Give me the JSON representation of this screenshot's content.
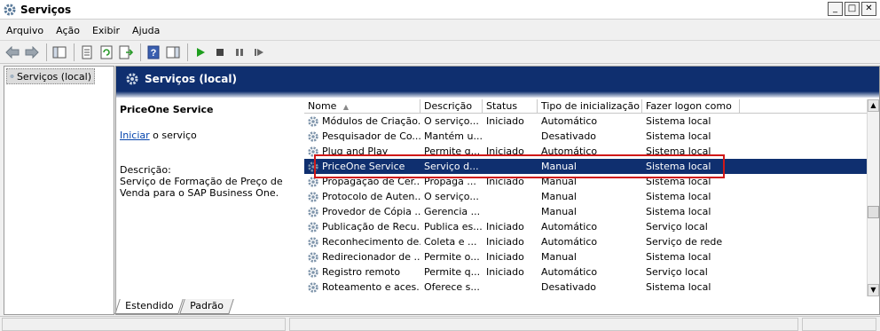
{
  "window": {
    "title": "Serviços",
    "app_icon": "gear-icon",
    "controls": [
      "minimize",
      "maximize",
      "close"
    ]
  },
  "menu": [
    "Arquivo",
    "Ação",
    "Exibir",
    "Ajuda"
  ],
  "toolbar_icons": [
    "back-arrow-icon",
    "forward-arrow-icon",
    "show-hide-tree-icon",
    "properties-icon",
    "refresh-icon",
    "export-list-icon",
    "help-icon",
    "show-hide-action-pane-icon",
    "play-icon",
    "stop-icon",
    "pause-icon",
    "restart-icon"
  ],
  "tree": {
    "root": "Serviços (local)"
  },
  "main": {
    "header": "Serviços (local)",
    "description_panel": {
      "service_name": "PriceOne Service",
      "start_link": "Iniciar",
      "start_suffix": " o serviço",
      "desc_label": "Descrição:",
      "desc_text": "Serviço de Formação de Preço de Venda para o SAP Business One."
    },
    "columns": [
      "Nome",
      "Descrição",
      "Status",
      "Tipo de inicialização",
      "Fazer logon como"
    ],
    "rows": [
      {
        "name": "Módulos de Criação...",
        "desc": "O serviço...",
        "status": "Iniciado",
        "type": "Automático",
        "logon": "Sistema local"
      },
      {
        "name": "Pesquisador de Co...",
        "desc": "Mantém u...",
        "status": "",
        "type": "Desativado",
        "logon": "Sistema local"
      },
      {
        "name": "Plug and Play",
        "desc": "Permite q...",
        "status": "Iniciado",
        "type": "Automático",
        "logon": "Sistema local"
      },
      {
        "name": "PriceOne Service",
        "desc": "Serviço d...",
        "status": "",
        "type": "Manual",
        "logon": "Sistema local"
      },
      {
        "name": "Propagação de Cer...",
        "desc": "Propaga ...",
        "status": "Iniciado",
        "type": "Manual",
        "logon": "Sistema local"
      },
      {
        "name": "Protocolo de Auten...",
        "desc": "O serviço...",
        "status": "",
        "type": "Manual",
        "logon": "Sistema local"
      },
      {
        "name": "Provedor de Cópia ...",
        "desc": "Gerencia ...",
        "status": "",
        "type": "Manual",
        "logon": "Sistema local"
      },
      {
        "name": "Publicação de Recu...",
        "desc": "Publica es...",
        "status": "Iniciado",
        "type": "Automático",
        "logon": "Serviço local"
      },
      {
        "name": "Reconhecimento de...",
        "desc": "Coleta e ...",
        "status": "Iniciado",
        "type": "Automático",
        "logon": "Serviço de rede"
      },
      {
        "name": "Redirecionador de ...",
        "desc": "Permite o...",
        "status": "Iniciado",
        "type": "Manual",
        "logon": "Sistema local"
      },
      {
        "name": "Registro remoto",
        "desc": "Permite q...",
        "status": "Iniciado",
        "type": "Automático",
        "logon": "Serviço local"
      },
      {
        "name": "Roteamento e aces...",
        "desc": "Oferece s...",
        "status": "",
        "type": "Desativado",
        "logon": "Sistema local"
      }
    ],
    "selected_row": "PriceOne Service"
  },
  "tabs": [
    "Estendido",
    "Padrão"
  ],
  "colors": {
    "header_bg": "#0f2f6f",
    "selection_bg": "#0f2f6f",
    "highlight_box": "#d01818",
    "link": "#0645ad"
  }
}
